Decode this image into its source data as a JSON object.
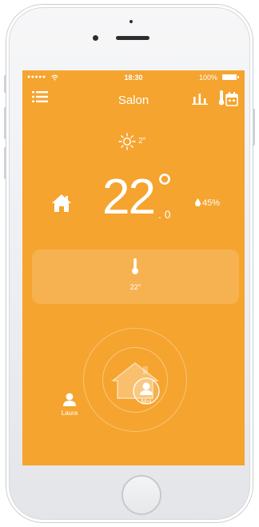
{
  "status_bar": {
    "signal": "●●●●●",
    "time": "18:30",
    "battery": "100%"
  },
  "header": {
    "title": "Salon",
    "icons": [
      "menu-icon",
      "stats-icon",
      "schedule-icon"
    ]
  },
  "weather": {
    "icon": "sun-icon",
    "outside_temp": "2°"
  },
  "room": {
    "temp_integer": "22",
    "temp_degree": "°",
    "temp_decimal": ". 0",
    "humidity": "45%"
  },
  "target": {
    "icon": "thermometer-icon",
    "temp": "22°"
  },
  "presence": {
    "users": [
      {
        "name": "Moi",
        "at_home": true
      },
      {
        "name": "Laura",
        "at_home": false
      }
    ]
  },
  "colors": {
    "accent": "#f5a42f",
    "text": "#ffffff"
  }
}
